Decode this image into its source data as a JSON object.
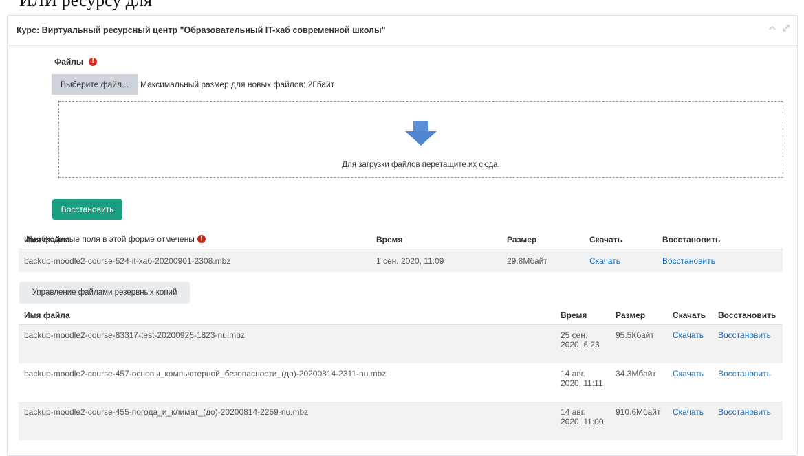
{
  "cutoff_text": "ИЛИ ресурсу для",
  "panel": {
    "title": "Курс: Виртуальный ресурсный центр \"Образовательный IT-хаб современной школы\""
  },
  "upload": {
    "files_label": "Файлы",
    "choose_button": "Выберите файл...",
    "max_size": "Максимальный размер для новых файлов: 2Гбайт",
    "drop_text": "Для загрузки файлов перетащите их сюда."
  },
  "restore_button": "Восстановить",
  "required_note": "Необходимые поля в этой форме отмечены",
  "course_backups": {
    "headers": [
      "Имя файла",
      "Время",
      "Размер",
      "Скачать",
      "Восстановить"
    ],
    "rows": [
      {
        "filename": "backup-moodle2-course-524-it-хаб-20200901-2308.mbz",
        "time": "1 сен. 2020, 11:09",
        "size": "29.8Мбайт",
        "download": "Скачать",
        "restore": "Восстановить"
      }
    ]
  },
  "manage_button": "Управление файлами резервных копий",
  "user_backups": {
    "headers": [
      "Имя файла",
      "Время",
      "Размер",
      "Скачать",
      "Восстановить"
    ],
    "rows": [
      {
        "filename": "backup-moodle2-course-83317-test-20200925-1823-nu.mbz",
        "time_line1": "25 сен.",
        "time_line2": "2020, 6:23",
        "size": "95.5Кбайт",
        "download": "Скачать",
        "restore": "Восстановить"
      },
      {
        "filename": "backup-moodle2-course-457-основы_компьютерной_безопасности_(до)-20200814-2311-nu.mbz",
        "time_line1": "14 авг.",
        "time_line2": "2020, 11:11",
        "size": "34.3Мбайт",
        "download": "Скачать",
        "restore": "Восстановить"
      },
      {
        "filename": "backup-moodle2-course-455-погода_и_климат_(до)-20200814-2259-nu.mbz",
        "time_line1": "14 авг.",
        "time_line2": "2020, 11:00",
        "size": "910.6Мбайт",
        "download": "Скачать",
        "restore": "Восстановить"
      }
    ]
  },
  "colors": {
    "primary": "#1a9e82",
    "link": "#0f6fc5",
    "required": "#ca3120"
  }
}
